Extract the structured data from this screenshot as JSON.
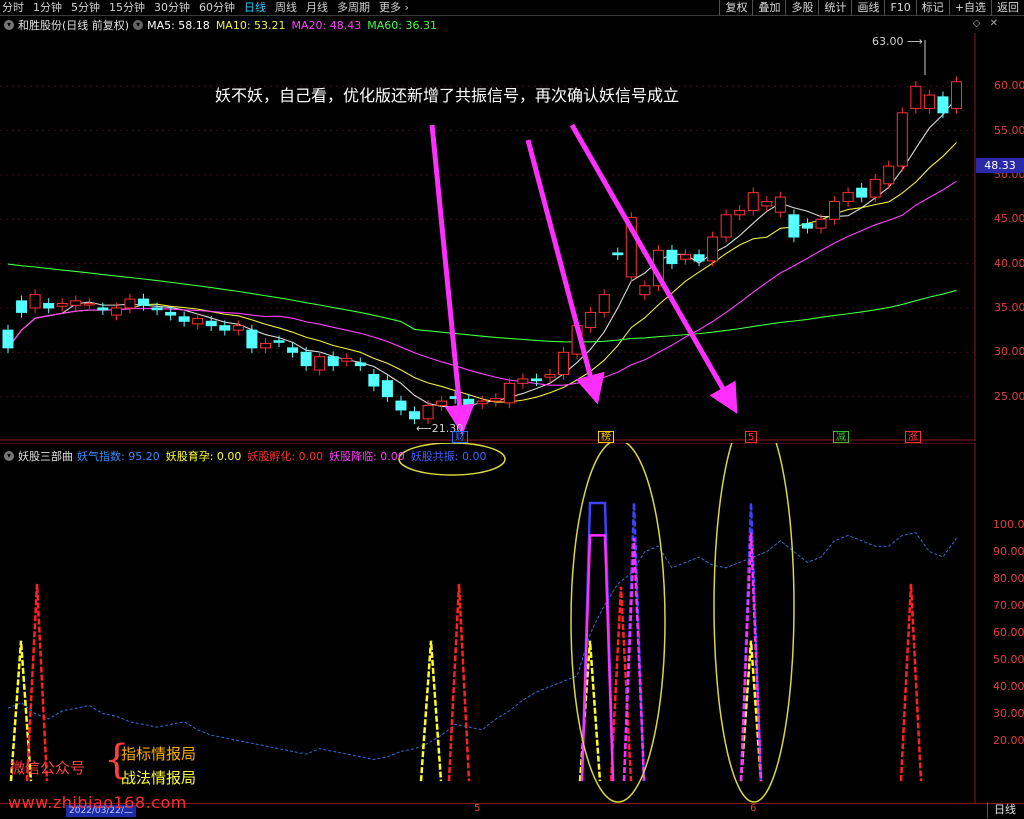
{
  "toolbar": {
    "periods": [
      "分时",
      "1分钟",
      "5分钟",
      "15分钟",
      "30分钟",
      "60分钟",
      "日线",
      "周线",
      "月线",
      "多周期",
      "更多 ›"
    ],
    "active_period": "日线",
    "tools": [
      "复权",
      "叠加",
      "多股",
      "统计",
      "画线",
      "F10",
      "标记",
      "+自选",
      "返回"
    ]
  },
  "main": {
    "title": "和胜股份(日线 前复权)",
    "ma_labels": [
      {
        "text": "MA5: 58.18",
        "color": "#ffffff"
      },
      {
        "text": "MA10: 53.21",
        "color": "#f0f040"
      },
      {
        "text": "MA20: 48.43",
        "color": "#ff40ff"
      },
      {
        "text": "MA60: 36.31",
        "color": "#40ff40"
      }
    ],
    "headline": "妖不妖，自己看，优化版还新增了共振信号，再次确认妖信号成立",
    "high_label": "63.00",
    "low_label": "21.30",
    "last_price": "48.33",
    "price_ticks": [
      "60.00",
      "55.00",
      "50.00",
      "45.00",
      "40.00",
      "35.00",
      "30.00",
      "25.00"
    ],
    "marks": [
      {
        "text": "财",
        "color": "#3070ff"
      },
      {
        "text": "榜",
        "color": "#ffcc00"
      },
      {
        "text": "5",
        "color": "#ff3030"
      },
      {
        "text": "减",
        "color": "#30c030"
      },
      {
        "text": "涨",
        "color": "#ff3030"
      }
    ]
  },
  "indicator": {
    "name": "妖股三部曲",
    "values": [
      {
        "text": "妖气指数: 95.20",
        "color": "#3a8cff"
      },
      {
        "text": "妖股育孕: 0.00",
        "color": "#ffff30"
      },
      {
        "text": "妖股孵化: 0.00",
        "color": "#ff3030"
      },
      {
        "text": "妖股降临: 0.00",
        "color": "#ff40ff"
      },
      {
        "text": "妖股共振: 0.00",
        "color": "#4060ff"
      }
    ],
    "ticks": [
      "100.00",
      "90.00",
      "80.00",
      "70.00",
      "60.00",
      "50.00",
      "40.00",
      "30.00",
      "20.00"
    ]
  },
  "footer": {
    "date_box": "2022/03/22/二",
    "ticks": [
      "5",
      "6"
    ],
    "period_box": "日线",
    "wechat": "微信公众号",
    "brace": "{",
    "bureau1": "指标情报局",
    "bureau2": "战法情报局",
    "website": "www.zhibiao168.com"
  },
  "chart_data": {
    "type": "candlestick",
    "ylim": [
      20,
      66
    ],
    "closes": [
      30.5,
      34.5,
      36.5,
      35.0,
      35.5,
      35.8,
      35.5,
      34.8,
      35.0,
      36.0,
      35.3,
      34.8,
      34.2,
      33.5,
      33.8,
      33.0,
      32.5,
      33.0,
      30.5,
      31.0,
      31.2,
      30.0,
      28.5,
      29.5,
      28.5,
      29.3,
      28.5,
      26.2,
      25.0,
      23.5,
      22.5,
      24.0,
      24.5,
      24.8,
      24.0,
      24.5,
      24.8,
      26.5,
      27.0,
      26.8,
      27.5,
      30.0,
      33.0,
      34.5,
      36.5,
      41.0,
      45.2,
      37.5,
      41.5,
      40.0,
      41.0,
      40.3,
      43.0,
      45.5,
      46.0,
      48.0,
      47.0,
      47.5,
      43.0,
      44.0,
      45.0,
      47.0,
      48.0,
      47.5,
      49.5,
      51.0,
      57.0,
      60.0,
      59.0,
      57.0,
      60.5
    ],
    "opens": [
      32.5,
      35.8,
      35.0,
      35.5,
      35.2,
      35.3,
      35.5,
      35.0,
      34.2,
      35.0,
      36.0,
      35.0,
      34.5,
      34.0,
      33.2,
      33.5,
      33.0,
      32.5,
      32.5,
      30.5,
      31.3,
      30.5,
      30.0,
      28.0,
      29.5,
      29.0,
      28.8,
      27.5,
      26.8,
      24.5,
      23.3,
      22.5,
      24.0,
      25.0,
      24.7,
      24.2,
      24.5,
      24.3,
      26.5,
      27.0,
      27.2,
      27.5,
      29.8,
      32.8,
      34.5,
      41.2,
      38.5,
      36.5,
      37.5,
      41.5,
      40.5,
      41.0,
      40.3,
      43.0,
      45.5,
      46.0,
      46.5,
      45.8,
      45.5,
      44.5,
      44.0,
      45.0,
      47.0,
      48.5,
      47.5,
      49.0,
      51.0,
      57.5,
      57.5,
      58.8,
      57.5
    ],
    "ma_series": [
      {
        "name": "MA5",
        "color": "#ffffff"
      },
      {
        "name": "MA10",
        "color": "#f0f040"
      },
      {
        "name": "MA20",
        "color": "#ff40ff"
      },
      {
        "name": "MA60",
        "color": "#40ff40"
      }
    ]
  }
}
